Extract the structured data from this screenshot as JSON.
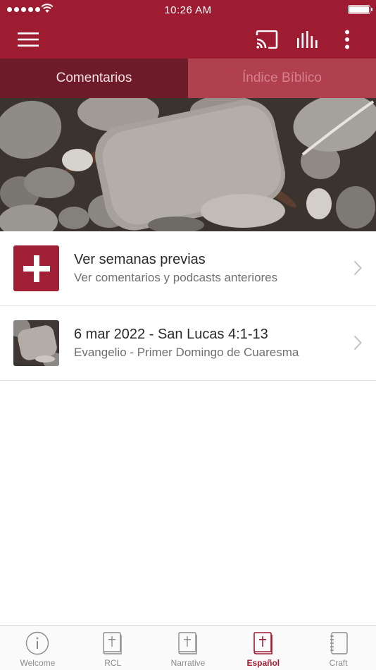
{
  "status_bar": {
    "time": "10:26 AM"
  },
  "colors": {
    "brand": "#9e1c32",
    "tab_active": "#6e1c29",
    "tab_inactive": "#b1404f"
  },
  "toolbar": {
    "icons": [
      "menu-icon",
      "cast-icon",
      "equalizer-icon",
      "more-vertical-icon"
    ]
  },
  "tabs": [
    {
      "label": "Comentarios",
      "active": true
    },
    {
      "label": "Índice Bíblico",
      "active": false
    }
  ],
  "list": [
    {
      "title": "Ver semanas previas",
      "subtitle": "Ver comentarios y podcasts anteriores",
      "icon": "plus-icon"
    },
    {
      "title": "6 mar 2022 - San Lucas 4:1-13",
      "subtitle": "Evangelio - Primer Domingo de Cuaresma",
      "icon": "stones-thumbnail"
    }
  ],
  "tab_bar": {
    "items": [
      {
        "label": "Welcome",
        "icon": "info-icon",
        "active": false
      },
      {
        "label": "RCL",
        "icon": "bible-icon",
        "active": false
      },
      {
        "label": "Narrative",
        "icon": "bible-icon",
        "active": false
      },
      {
        "label": "Español",
        "icon": "bible-icon",
        "active": true
      },
      {
        "label": "Craft",
        "icon": "notebook-icon",
        "active": false
      }
    ]
  }
}
